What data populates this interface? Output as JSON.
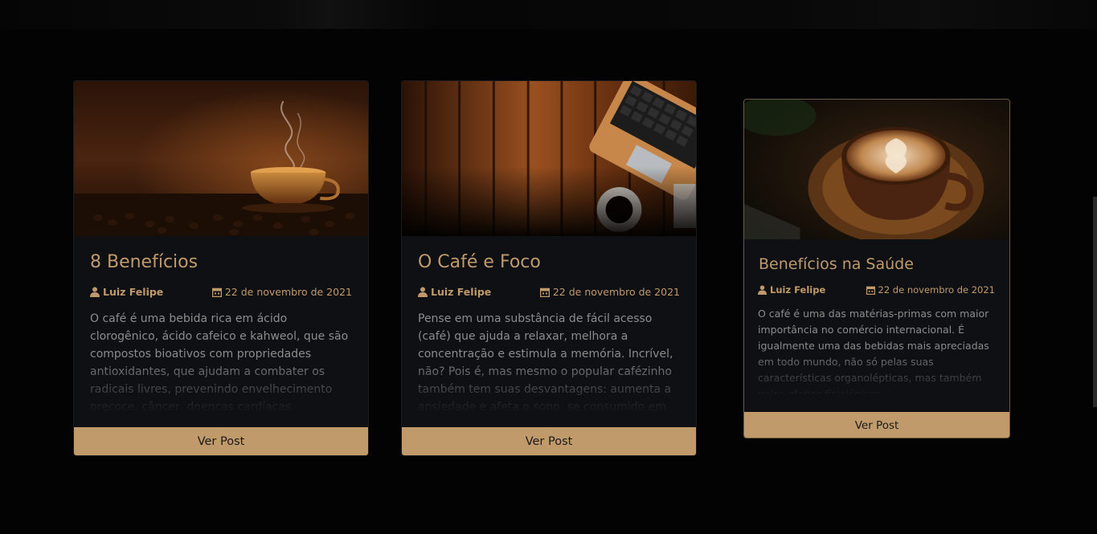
{
  "colors": {
    "accent": "#c19a6b",
    "card_bg": "#0f1014",
    "page_bg": "#030303",
    "text_muted": "#8d8c8b"
  },
  "posts": [
    {
      "title": "8 Benefícios",
      "author": "Luiz Felipe",
      "date": "22 de novembro de 2021",
      "excerpt": "O café é uma bebida rica em ácido clorogênico, ácido cafeico e kahweol, que são compostos bioativos com propriedades antioxidantes, que ajudam a combater os radicais livres, prevenindo envelhecimento precoce, câncer, doenças cardíacas",
      "button": "Ver Post",
      "image": "coffee-cup-with-beans"
    },
    {
      "title": "O Café e Foco",
      "author": "Luiz Felipe",
      "date": "22 de novembro de 2021",
      "excerpt": "Pense em uma substância de fácil acesso (café) que ajuda a relaxar, melhora a concentração e estimula a memória. Incrível, não? Pois é, mas mesmo o popular cafézinho também tem suas desvantagens: aumenta a ansiedade e afeta o sono, se consumido em excesso, entre outros",
      "button": "Ver Post",
      "image": "laptop-on-wooden-desk"
    },
    {
      "title": "Benefícios na Saúde",
      "author": "Luiz Felipe",
      "date": "22 de novembro de 2021",
      "excerpt": "O café é uma das matérias-primas com maior importância no comércio internacional. É igualmente uma das bebidas mais apreciadas em todo mundo, não só pelas suas características organolépticas, mas também pelos efeitos fisiológicos",
      "button": "Ver Post",
      "image": "latte-art-cup"
    }
  ]
}
